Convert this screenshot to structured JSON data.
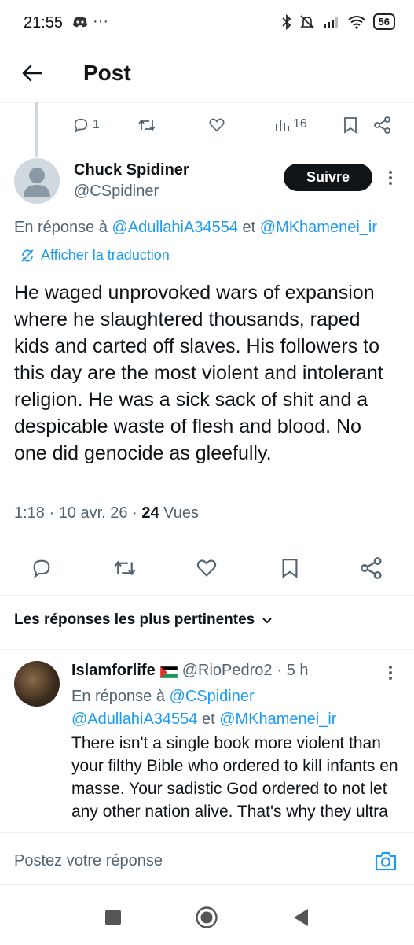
{
  "status_bar": {
    "time": "21:55",
    "battery": "56",
    "left_icons": [
      "discord-icon",
      "more-icon"
    ],
    "right_icons": [
      "bluetooth-icon",
      "mute-icon",
      "signal-icon",
      "wifi-icon",
      "battery-icon"
    ]
  },
  "header": {
    "title": "Post"
  },
  "parent_actions": {
    "replies": "1",
    "retweets": "",
    "likes": "",
    "views": "16"
  },
  "tweet": {
    "name": "Chuck Spidiner",
    "handle": "@CSpidiner",
    "follow_label": "Suivre",
    "reply_prefix": "En réponse à ",
    "reply_user1": "@AdullahiA34554",
    "reply_and": " et ",
    "reply_user2": "@MKhamenei_ir",
    "translate_label": "Afficher la traduction",
    "text": "He waged unprovoked wars of expansion where he slaughtered thousands, raped kids and carted off slaves. His followers to this day are the most violent and intolerant religion. He was a sick sack of shit and a despicable waste of flesh and blood. No one did genocide as gleefully.",
    "time": "1:18 · 10 avr. 26 · ",
    "views_count": "24",
    "views_label": " Vues"
  },
  "replies_sort": {
    "label": "Les réponses les plus pertinentes"
  },
  "reply": {
    "name": "Islamforlife",
    "handle": "@RioPedro2",
    "time": "· 5 h",
    "reply_prefix": "En réponse à ",
    "reply_user0": "@CSpidiner",
    "reply_user1": "@AdullahiA34554",
    "reply_and": " et ",
    "reply_user2": "@MKhamenei_ir",
    "text": "There isn't a single book more violent than your filthy Bible who ordered to kill infants en masse. Your sadistic God ordered to not let any  other nation alive. That's why they ultra"
  },
  "composer": {
    "placeholder": "Postez votre réponse"
  },
  "colors": {
    "accent": "#1d9bf0",
    "text": "#0f1419",
    "muted": "#536471"
  }
}
